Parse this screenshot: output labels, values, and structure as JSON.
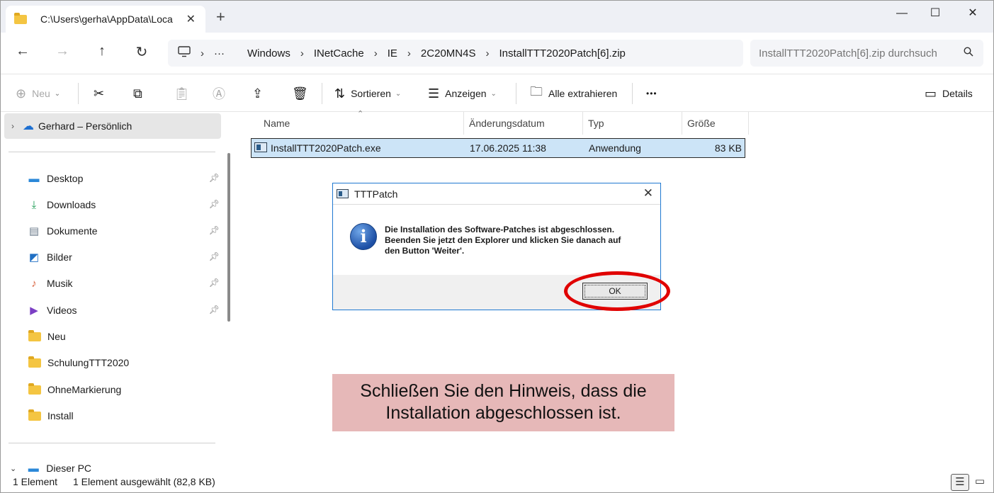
{
  "window": {
    "tab_title": "C:\\Users\\gerha\\AppData\\Loca",
    "tab_close": "✕",
    "new_tab": "+",
    "minimize": "—",
    "maximize": "☐",
    "close": "✕"
  },
  "nav": {
    "back": "←",
    "forward": "→",
    "up": "↑",
    "refresh": "↻",
    "breadcrumbs": [
      "Windows",
      "INetCache",
      "IE",
      "2C20MN4S",
      "InstallTTT2020Patch[6].zip"
    ],
    "search_placeholder": "InstallTTT2020Patch[6].zip durchsuch"
  },
  "toolbar": {
    "new_label": "Neu",
    "sort_label": "Sortieren",
    "view_label": "Anzeigen",
    "extract_label": "Alle extrahieren",
    "more_label": "•••",
    "details_label": "Details"
  },
  "sidebar": {
    "top_item": "Gerhard – Persönlich",
    "quick_access": [
      {
        "label": "Desktop",
        "icon": "desktop-icon",
        "pinned": true
      },
      {
        "label": "Downloads",
        "icon": "download-icon",
        "pinned": true
      },
      {
        "label": "Dokumente",
        "icon": "document-icon",
        "pinned": true
      },
      {
        "label": "Bilder",
        "icon": "picture-icon",
        "pinned": true
      },
      {
        "label": "Musik",
        "icon": "music-icon",
        "pinned": true
      },
      {
        "label": "Videos",
        "icon": "video-icon",
        "pinned": true
      },
      {
        "label": "Neu",
        "icon": "folder-icon",
        "pinned": false
      },
      {
        "label": "SchulungTTT2020",
        "icon": "folder-icon",
        "pinned": false
      },
      {
        "label": "OhneMarkierung",
        "icon": "folder-icon",
        "pinned": false
      },
      {
        "label": "Install",
        "icon": "folder-icon",
        "pinned": false
      }
    ],
    "this_pc": "Dieser PC"
  },
  "file_list": {
    "columns": [
      "Name",
      "Änderungsdatum",
      "Typ",
      "Größe"
    ],
    "rows": [
      {
        "name": "InstallTTT2020Patch.exe",
        "date": "17.06.2025 11:38",
        "type": "Anwendung",
        "size": "83 KB"
      }
    ]
  },
  "dialog": {
    "title": "TTTPatch",
    "close": "✕",
    "message_line1": "Die Installation des Software-Patches ist abgeschlossen.",
    "message_line2": "Beenden Sie jetzt den Explorer und klicken Sie danach auf",
    "message_line3": "den Button 'Weiter'.",
    "ok_label": "OK"
  },
  "callout": {
    "line1": "Schließen Sie den Hinweis, dass die",
    "line2": "Installation abgeschlossen ist."
  },
  "status": {
    "count": "1 Element",
    "selection": "1 Element ausgewählt (82,8 KB)"
  },
  "colors": {
    "selection": "#cce4f7",
    "dialog_border": "#1f78d1",
    "highlight_ring": "#e00000",
    "callout_bg": "#e6b8b8"
  }
}
